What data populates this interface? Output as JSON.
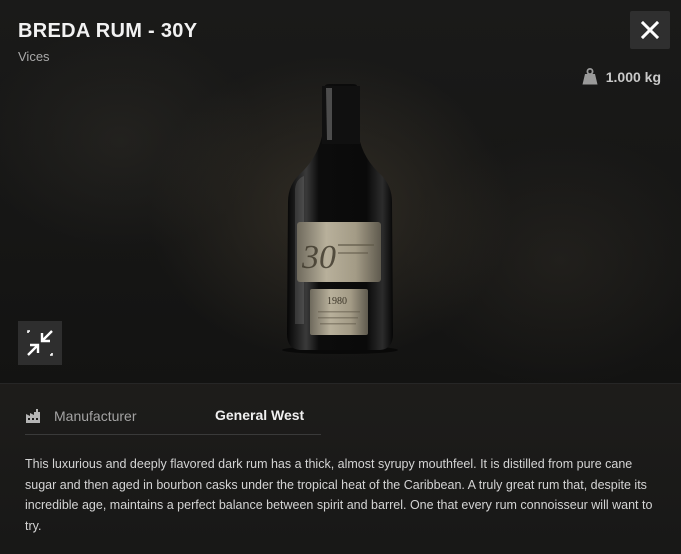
{
  "item": {
    "title": "BREDA RUM - 30Y",
    "category": "Vices",
    "weight": "1.000 kg",
    "icons": {
      "close": "close-icon",
      "weight": "weight-icon",
      "collapse": "collapse-icon",
      "manufacturer": "factory-icon"
    },
    "bottle_label": {
      "big_number": "30",
      "year": "1980"
    },
    "colors": {
      "background": "#141413",
      "button": "#2f2f2f",
      "text": "#e8e8e8",
      "muted": "#a3a3a3"
    }
  },
  "specs": [
    {
      "label": "Manufacturer",
      "value": "General West"
    }
  ],
  "description": "This luxurious and deeply flavored dark rum has a thick, almost syrupy mouthfeel. It is distilled from pure cane sugar and then aged in bourbon casks under the tropical heat of the Caribbean. A truly great rum that, despite its incredible age, maintains a perfect balance between spirit and barrel. One that every rum connoisseur will want to try."
}
